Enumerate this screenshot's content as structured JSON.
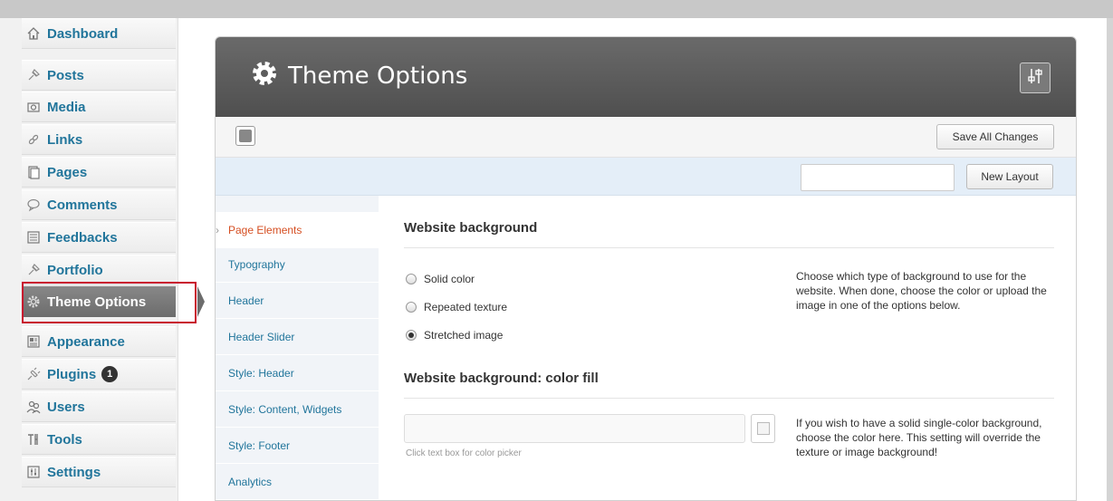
{
  "sidebar": {
    "items": [
      {
        "label": "Dashboard",
        "icon": "house-icon"
      },
      {
        "label": "Posts",
        "icon": "pin-icon"
      },
      {
        "label": "Media",
        "icon": "camera-icon"
      },
      {
        "label": "Links",
        "icon": "link-icon"
      },
      {
        "label": "Pages",
        "icon": "pages-icon"
      },
      {
        "label": "Comments",
        "icon": "comment-icon"
      },
      {
        "label": "Feedbacks",
        "icon": "feedback-icon"
      },
      {
        "label": "Portfolio",
        "icon": "pin-icon"
      },
      {
        "label": "Theme Options",
        "icon": "gear-icon"
      },
      {
        "label": "Appearance",
        "icon": "appearance-icon"
      },
      {
        "label": "Plugins",
        "icon": "plug-icon",
        "badge": "1"
      },
      {
        "label": "Users",
        "icon": "users-icon"
      },
      {
        "label": "Tools",
        "icon": "tools-icon"
      },
      {
        "label": "Settings",
        "icon": "settings-icon"
      }
    ]
  },
  "panel": {
    "title": "Theme Options",
    "save_label": "Save All Changes",
    "new_layout_label": "New Layout",
    "new_layout_value": ""
  },
  "tabs": [
    "Page Elements",
    "Typography",
    "Header",
    "Header Slider",
    "Style: Header",
    "Style: Content, Widgets",
    "Style: Footer",
    "Analytics"
  ],
  "content": {
    "section1_title": "Website background",
    "radio1": "Solid color",
    "radio2": "Repeated texture",
    "radio3": "Stretched image",
    "selected_radio": "Stretched image",
    "desc1": "Choose which type of background to use for the website. When done, choose the color or upload the image in one of the options below.",
    "section2_title": "Website background: color fill",
    "color_value": "",
    "hint": "Click text box for color picker",
    "desc2": "If you wish to have a solid single-color background, choose the color here. This setting will override the texture or image background!"
  },
  "colors": {
    "link": "#21759b",
    "active_tab": "#d54e21",
    "highlight": "#c8102e",
    "header_bg": "#5c5c5c"
  }
}
